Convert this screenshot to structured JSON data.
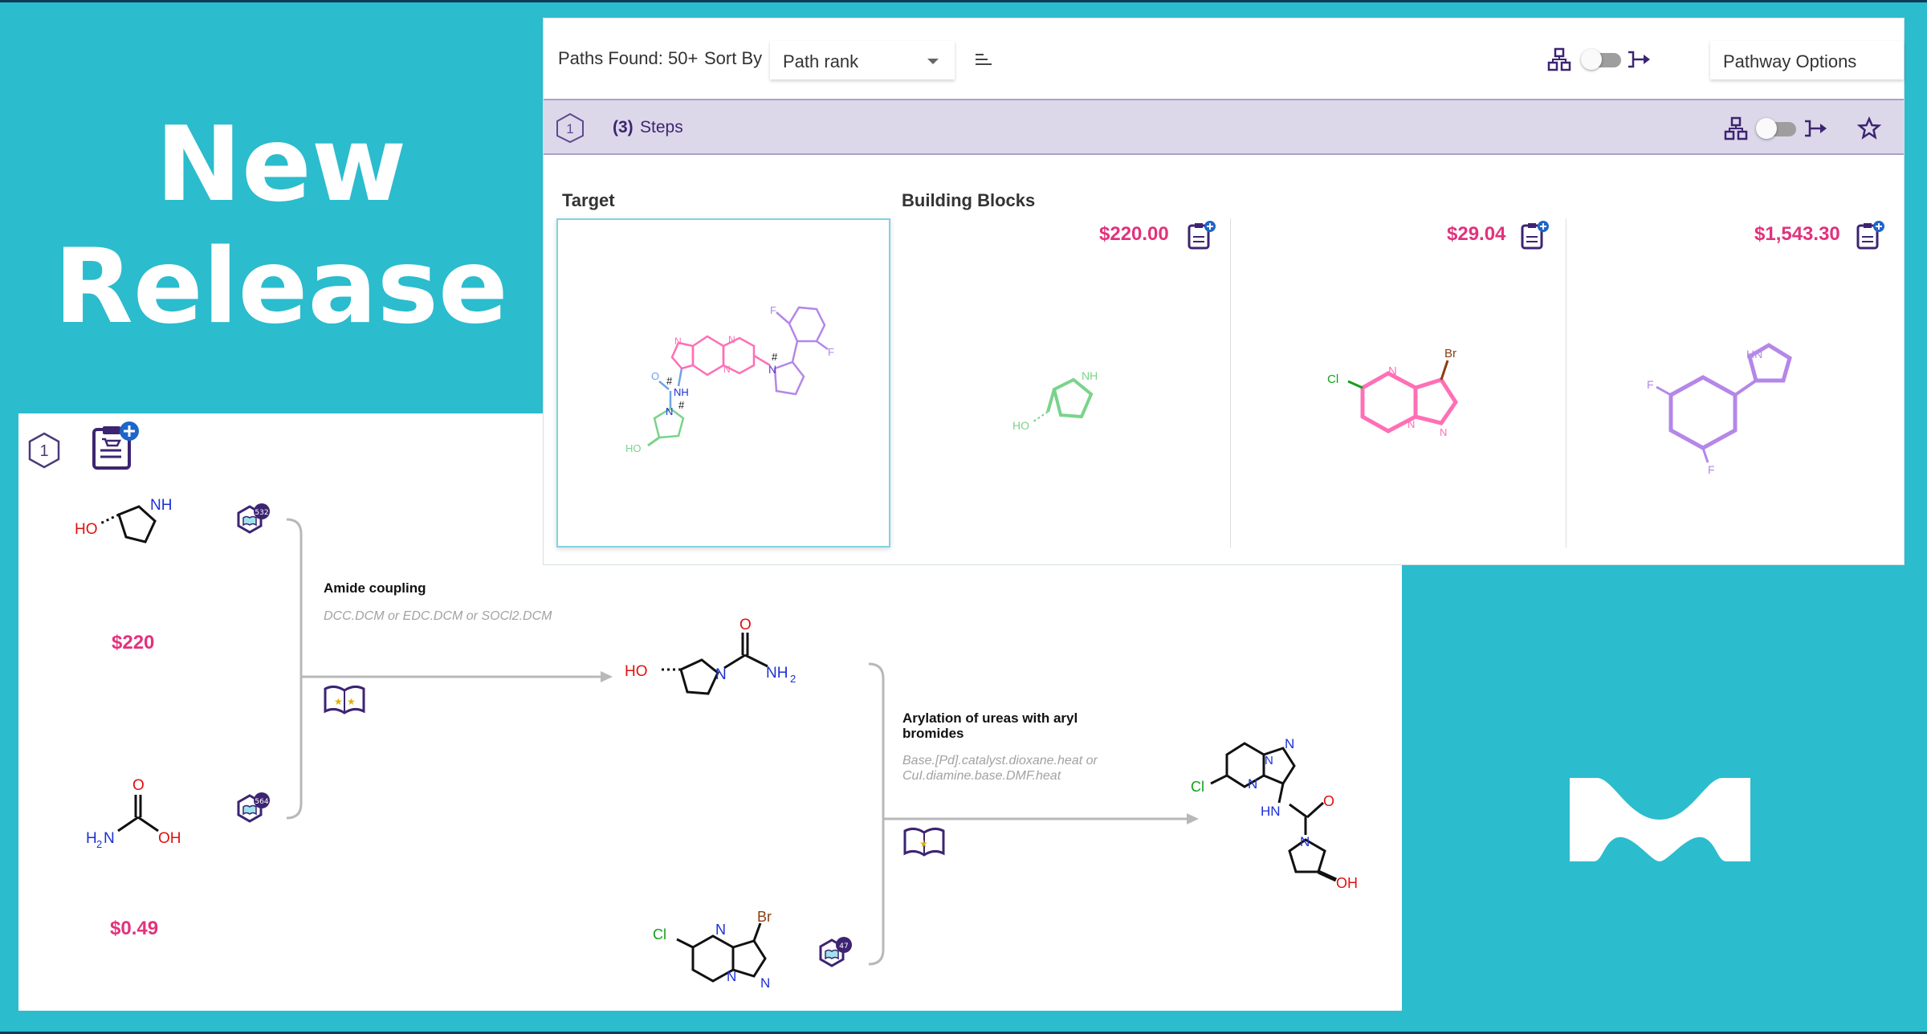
{
  "banner": {
    "headline_line1": "New",
    "headline_line2": "Release",
    "brand_logo_icon": "merck-m-logo",
    "background_color": "#2bbccd"
  },
  "pathway_detail": {
    "step_number": "1",
    "cart_icon": "add-to-cart-clipboard-icon",
    "starting_materials": [
      {
        "price": "$220",
        "reference_count": "532"
      },
      {
        "price": "$0.49",
        "reference_count": "564"
      }
    ],
    "third_material_reference_count": "47",
    "reactions": [
      {
        "title": "Amide coupling",
        "conditions": "DCC.DCM or EDC.DCM or SOCl2.DCM"
      },
      {
        "title": "Arylation of ureas with aryl bromides",
        "conditions": "Base.[Pd].catalyst.dioxane.heat or CuI.diamine.base.DMF.heat"
      }
    ]
  },
  "results": {
    "paths_found_label": "Paths Found: 50+",
    "sort_by_label": "Sort By",
    "sort_value": "Path rank",
    "pathway_options_label": "Pathway Options",
    "step_number": "1",
    "steps_count": "(3)",
    "steps_label": "Steps",
    "target_label": "Target",
    "building_blocks_label": "Building Blocks",
    "building_blocks": [
      {
        "price": "$220.00"
      },
      {
        "price": "$29.04"
      },
      {
        "price": "$1,543.30"
      }
    ]
  },
  "colors": {
    "accent_purple": "#3d2472",
    "price_pink": "#e2327d",
    "target_border": "#7fd4df",
    "step_bar": "#dcd8ea"
  }
}
